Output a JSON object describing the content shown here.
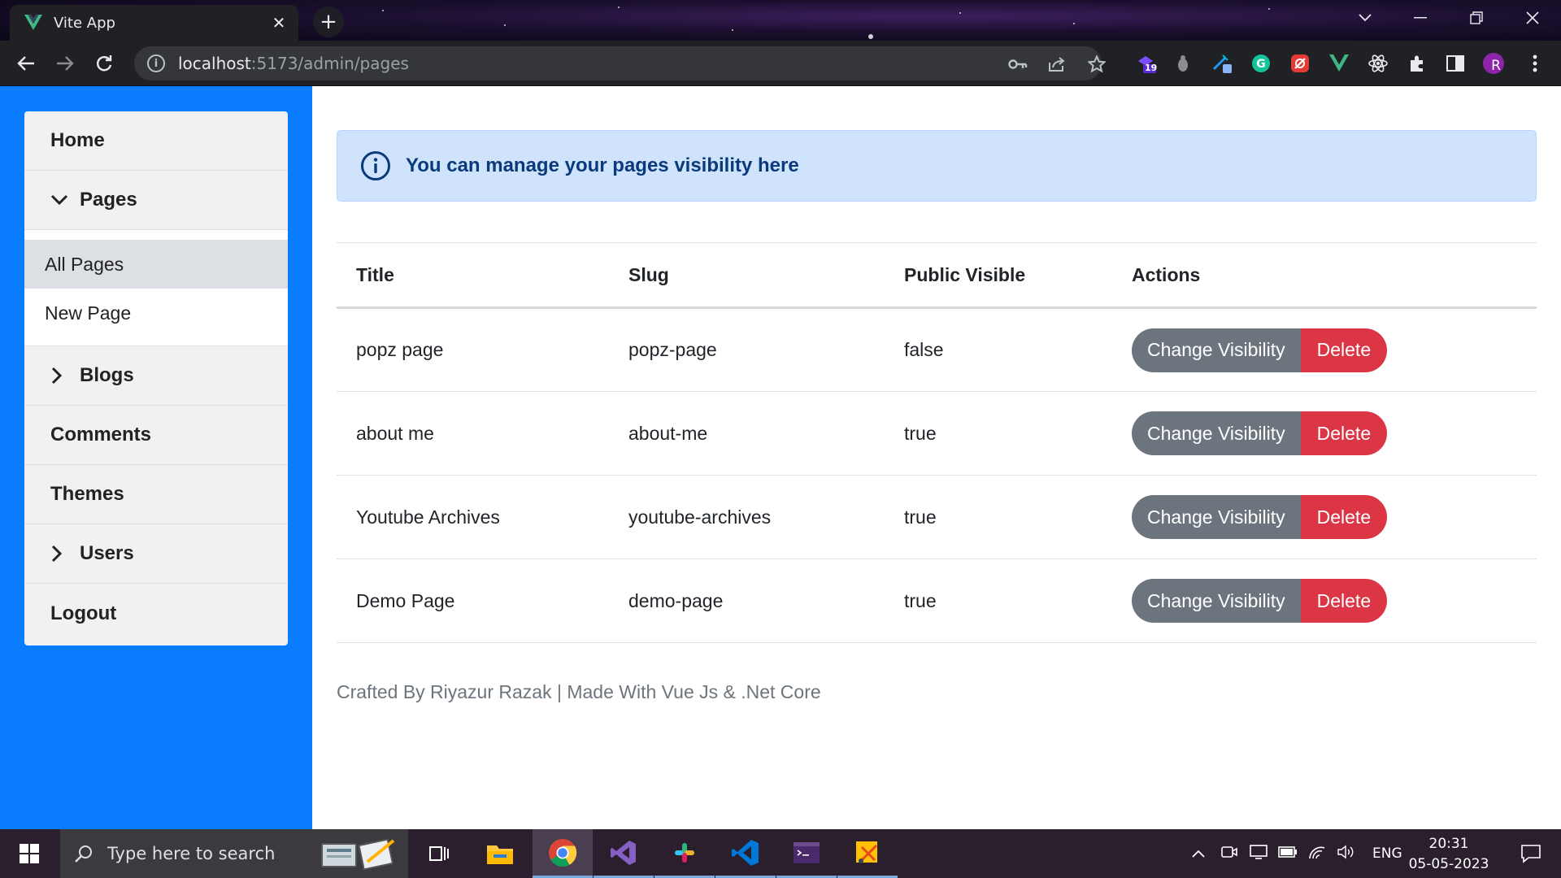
{
  "browser": {
    "tab_title": "Vite App",
    "url_host": "localhost",
    "url_rest": ":5173/admin/pages",
    "extension_badge": "19",
    "profile_initial": "R"
  },
  "sidebar": {
    "home": "Home",
    "pages": "Pages",
    "pages_sub": [
      "All Pages",
      "New Page"
    ],
    "blogs": "Blogs",
    "comments": "Comments",
    "themes": "Themes",
    "users": "Users",
    "logout": "Logout"
  },
  "alert": {
    "message": "You can manage your pages visibility here"
  },
  "table": {
    "headers": [
      "Title",
      "Slug",
      "Public Visible",
      "Actions"
    ],
    "rows": [
      {
        "title": "popz page",
        "slug": "popz-page",
        "visible": "false"
      },
      {
        "title": "about me",
        "slug": "about-me",
        "visible": "true"
      },
      {
        "title": "Youtube Archives",
        "slug": "youtube-archives",
        "visible": "true"
      },
      {
        "title": "Demo Page",
        "slug": "demo-page",
        "visible": "true"
      }
    ],
    "change_label": "Change Visibility",
    "delete_label": "Delete"
  },
  "footer": {
    "text": "Crafted By Riyazur Razak | Made With Vue Js & .Net Core"
  },
  "taskbar": {
    "search_placeholder": "Type here to search",
    "language": "ENG",
    "time": "20:31",
    "date": "05-05-2023"
  },
  "colors": {
    "sidebar_bg": "#0a7cff",
    "alert_bg": "#cfe4fc",
    "secondary_btn": "#6c757d",
    "danger_btn": "#dc3545"
  }
}
